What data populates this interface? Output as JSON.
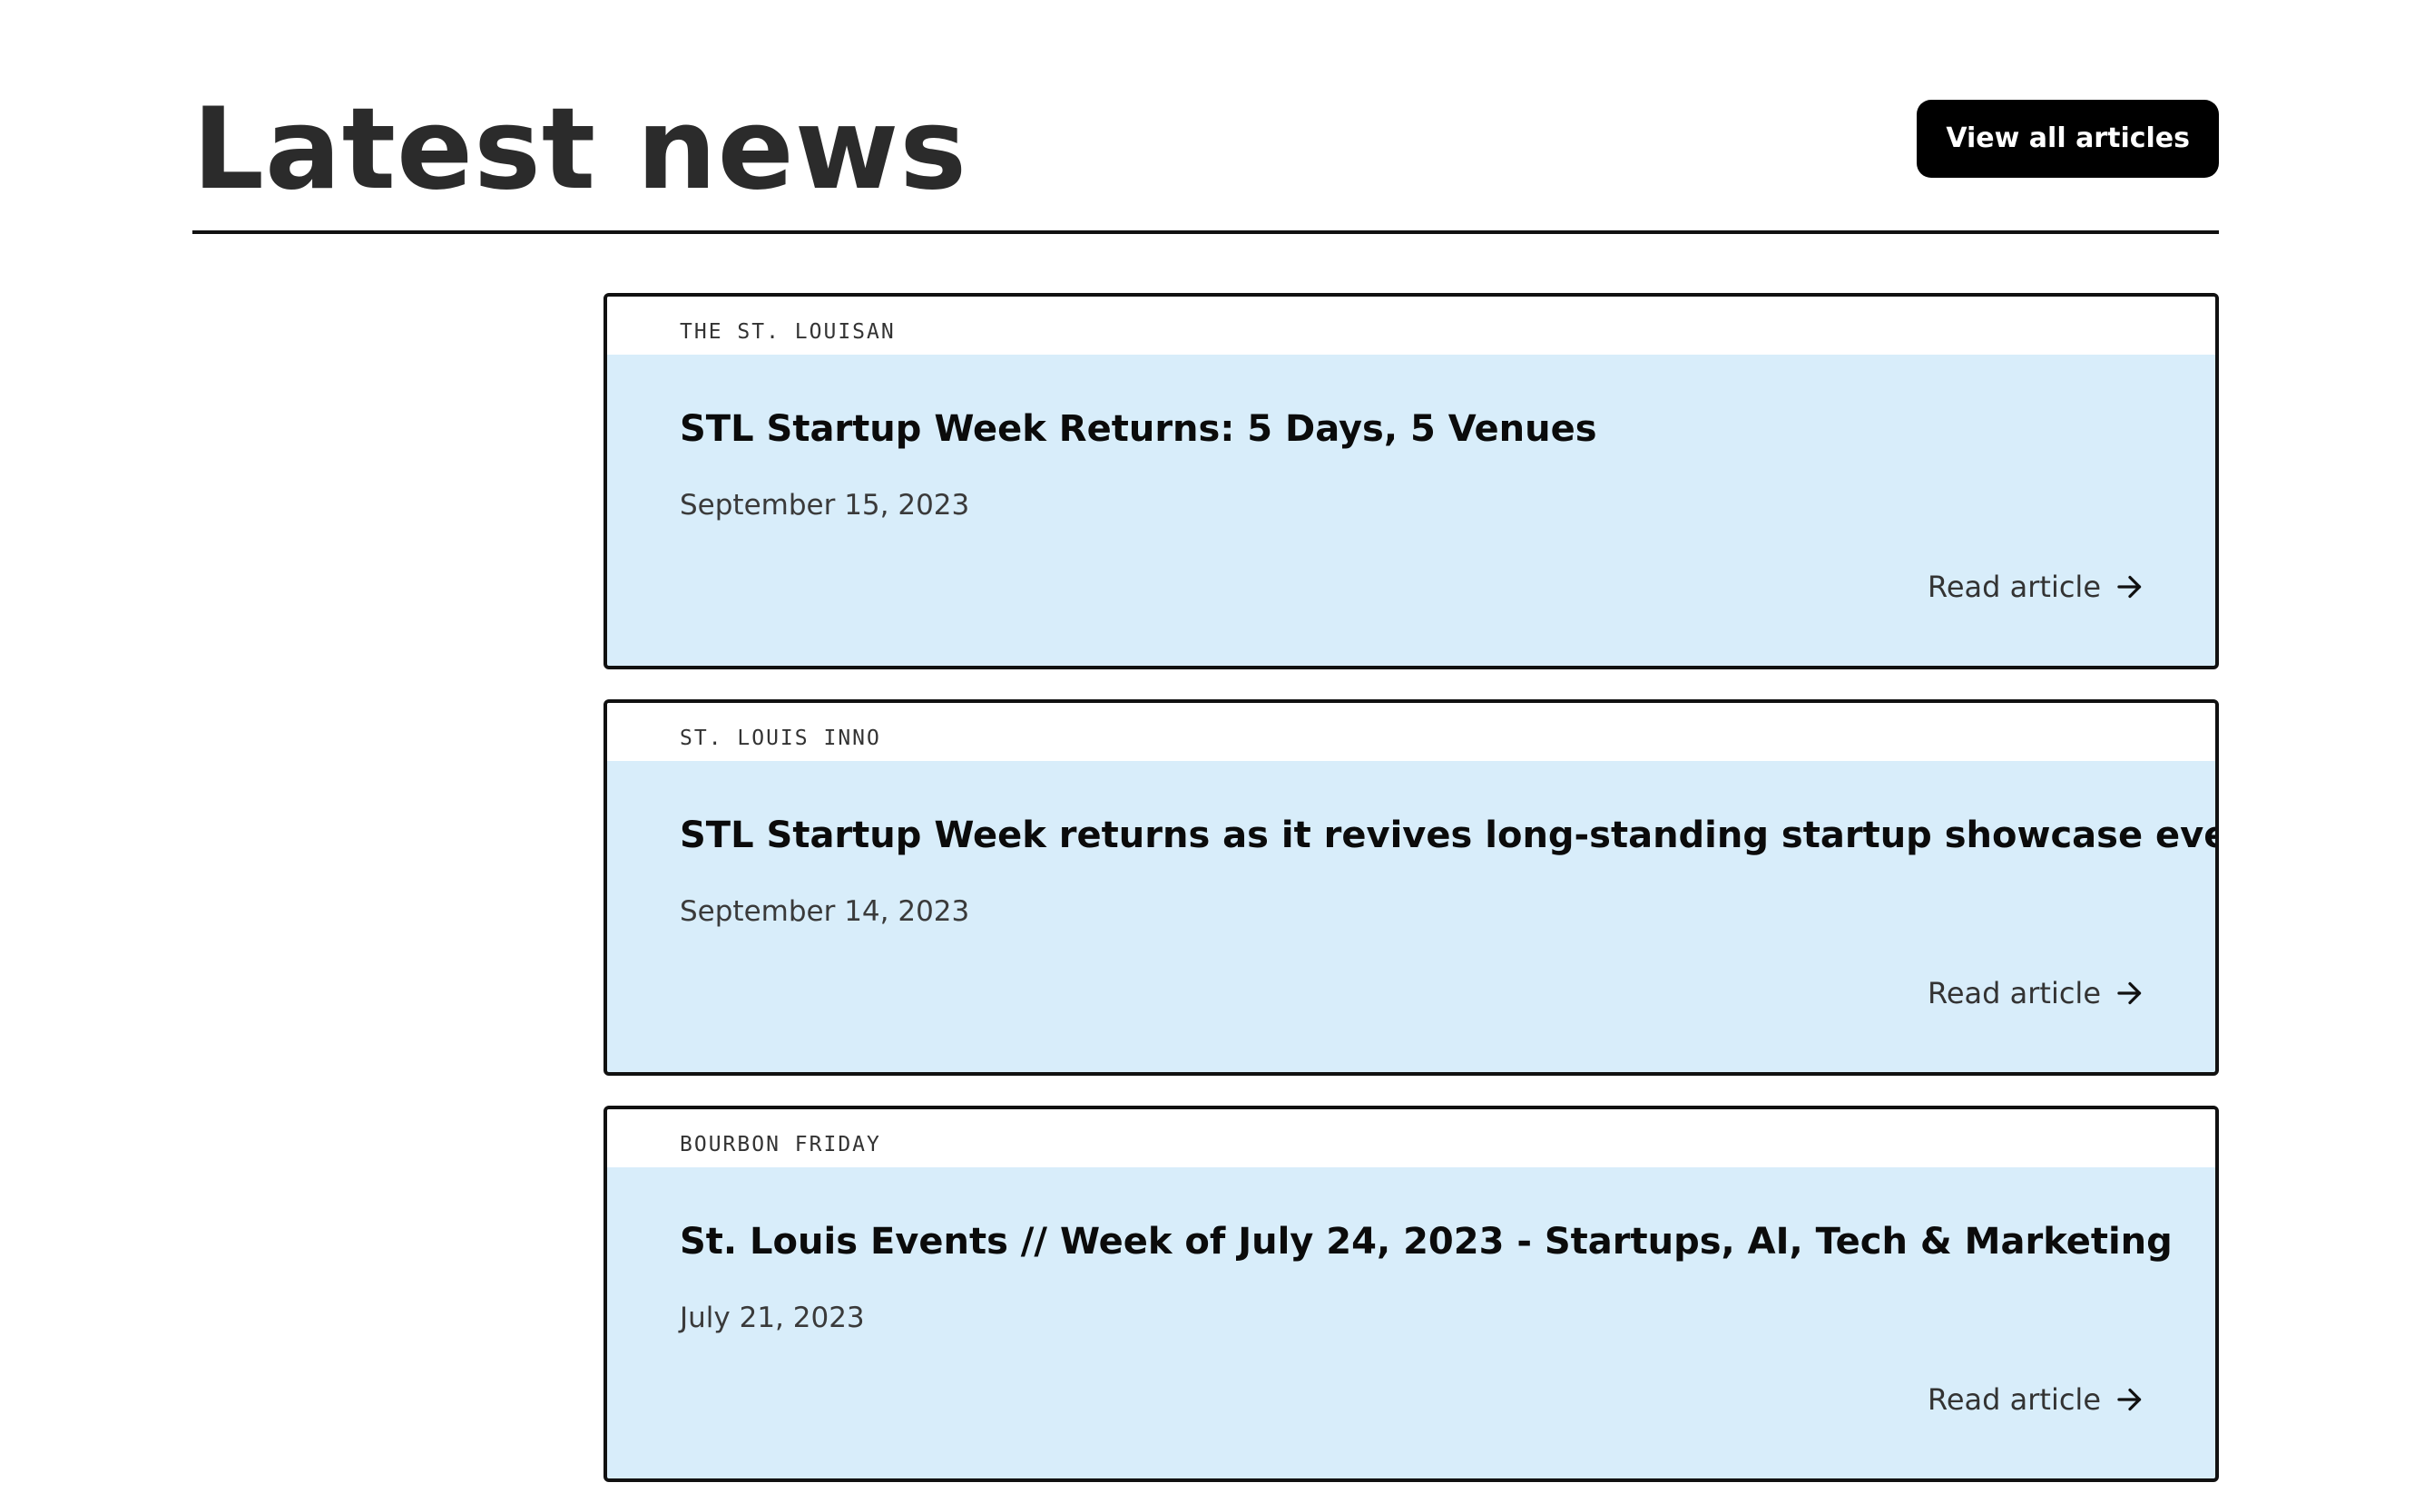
{
  "header": {
    "title": "Latest news",
    "view_all_label": "View all articles"
  },
  "articles": [
    {
      "source": "THE ST. LOUISAN",
      "title": "STL Startup Week Returns: 5 Days, 5 Venues",
      "date": "September 15, 2023",
      "link_label": "Read article"
    },
    {
      "source": "ST. LOUIS INNO",
      "title": "STL Startup Week returns as it revives long-standing startup showcase event",
      "date": "September 14, 2023",
      "link_label": "Read article"
    },
    {
      "source": "BOURBON FRIDAY",
      "title": "St. Louis Events // Week of July 24, 2023 - Startups, AI, Tech & Marketing",
      "date": "July 21, 2023",
      "link_label": "Read article"
    }
  ],
  "icons": {
    "read_article": "arrow-right-icon"
  },
  "colors": {
    "card_background": "#d8edfa",
    "button_background": "#000000",
    "border": "#111111"
  }
}
